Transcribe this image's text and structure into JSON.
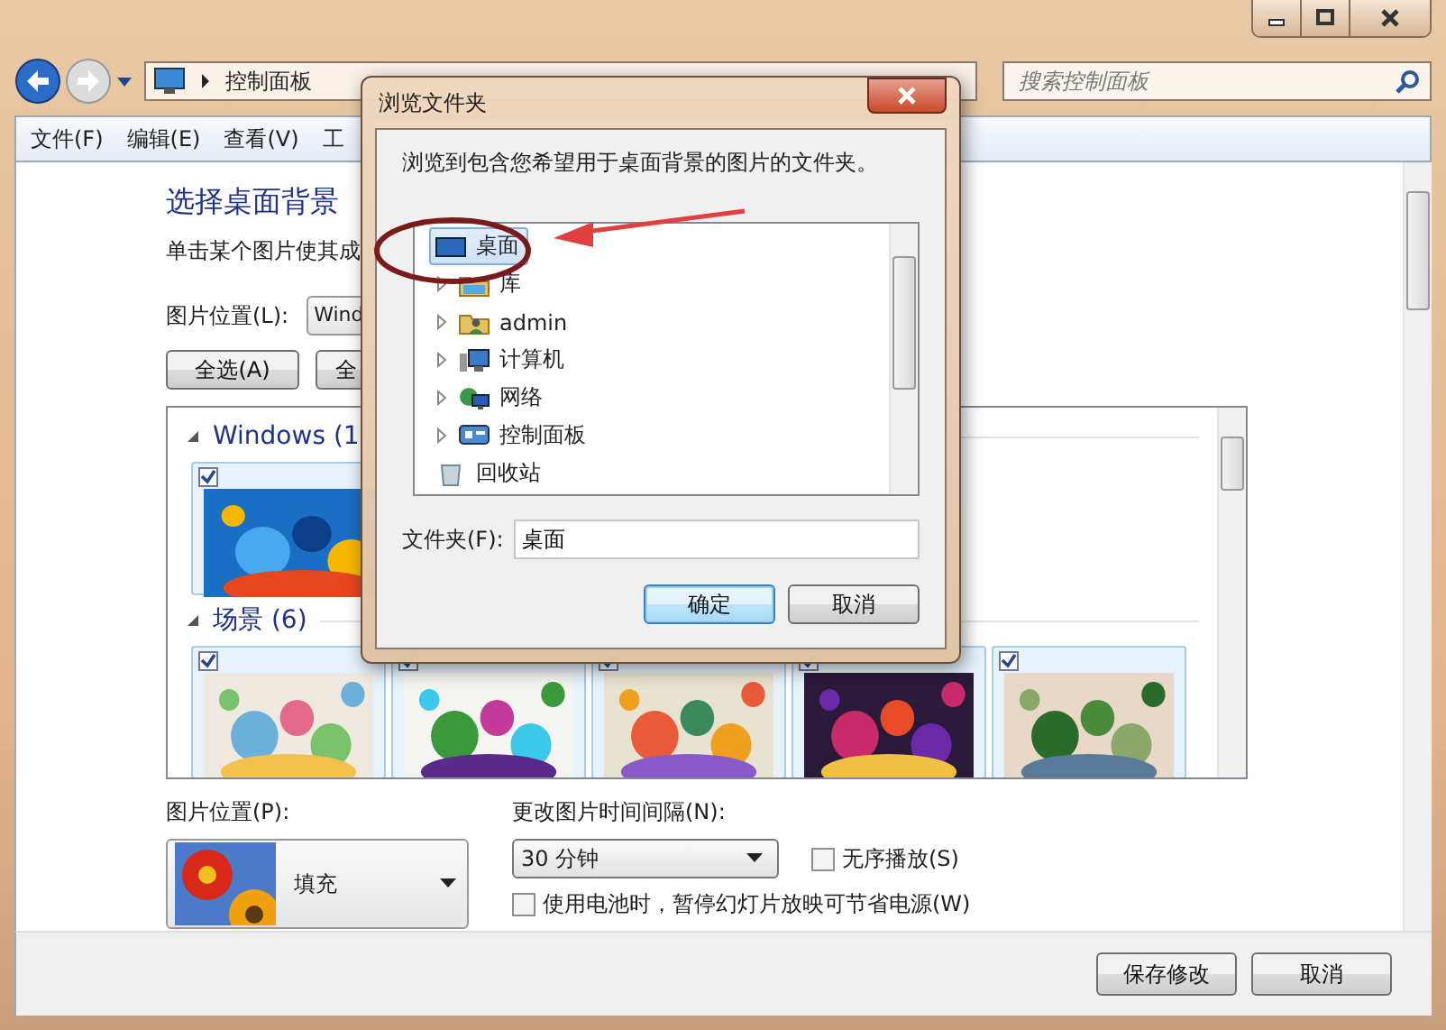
{
  "address_bar": {
    "crumbs": [
      "控制面板"
    ]
  },
  "search": {
    "placeholder": "搜索控制面板"
  },
  "menu": [
    "文件(F)",
    "编辑(E)",
    "查看(V)",
    "工"
  ],
  "page": {
    "title": "选择桌面背景",
    "subtitle": "单击某个图片使其成",
    "location_label": "图片位置(L):",
    "location_value": "Wind",
    "buttons": [
      "全选(A)",
      "全"
    ]
  },
  "gallery": {
    "groups": [
      {
        "name": "Windows (1",
        "expanded": true,
        "items": [
          {
            "checked": true
          }
        ]
      },
      {
        "name": "场景 (6)",
        "expanded": true,
        "items": [
          {
            "checked": true
          },
          {
            "checked": true
          },
          {
            "checked": true
          },
          {
            "checked": true
          },
          {
            "checked": true
          }
        ]
      }
    ]
  },
  "position": {
    "label": "图片位置(P):",
    "value": "填充"
  },
  "interval": {
    "label": "更改图片时间间隔(N):",
    "value": "30 分钟"
  },
  "options": [
    {
      "label": "无序播放(S)",
      "checked": false
    },
    {
      "label": "使用电池时，暂停幻灯片放映可节省电源(W)",
      "checked": false
    }
  ],
  "footer_buttons": [
    "保存修改",
    "取消"
  ],
  "dialog": {
    "title": "浏览文件夹",
    "prompt": "浏览到包含您希望用于桌面背景的图片的文件夹。",
    "tree": [
      {
        "label": "桌面",
        "kind": "desktop",
        "selected": true,
        "expandable": false
      },
      {
        "label": "库",
        "kind": "library",
        "selected": false,
        "expandable": true
      },
      {
        "label": "admin",
        "kind": "user",
        "selected": false,
        "expandable": true
      },
      {
        "label": "计算机",
        "kind": "computer",
        "selected": false,
        "expandable": true
      },
      {
        "label": "网络",
        "kind": "network",
        "selected": false,
        "expandable": true
      },
      {
        "label": "控制面板",
        "kind": "panel",
        "selected": false,
        "expandable": true
      },
      {
        "label": "回收站",
        "kind": "recycle",
        "selected": false,
        "expandable": false
      }
    ],
    "folder_label": "文件夹(F):",
    "folder_value": "桌面",
    "buttons": [
      {
        "label": "确定",
        "default": true
      },
      {
        "label": "取消",
        "default": false
      }
    ]
  }
}
